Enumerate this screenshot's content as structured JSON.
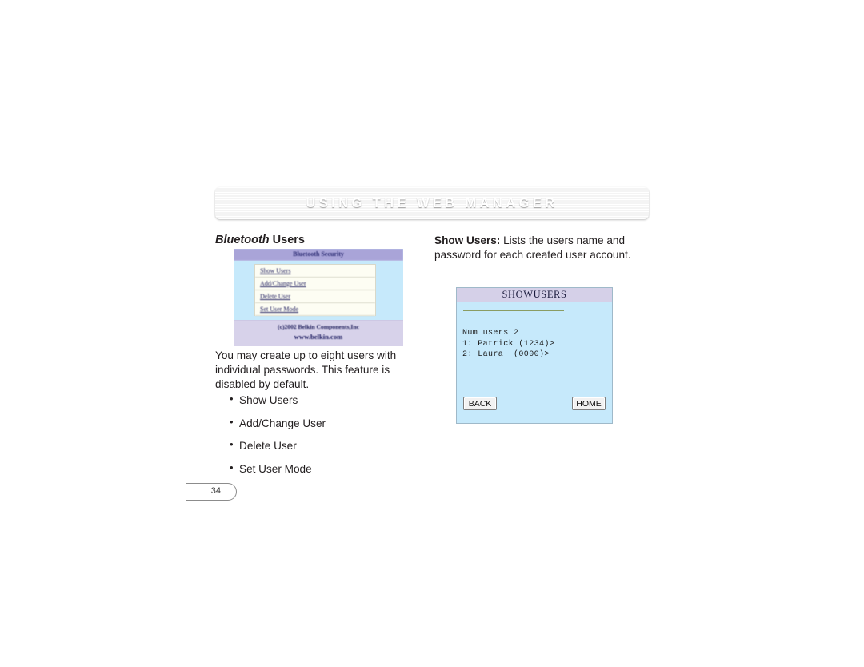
{
  "document": {
    "banner_title": "USING THE WEB MANAGER",
    "page_number": "34"
  },
  "left_column": {
    "heading_emphasis": "Bluetooth",
    "heading_rest": " Users",
    "paragraph": "You may create up to eight users with individual passwords. This feature is disabled by default.",
    "bullets": [
      "Show Users",
      "Add/Change User",
      "Delete User",
      "Set User Mode"
    ]
  },
  "right_column": {
    "lead": "Show Users:",
    "description": " Lists the users name and password for each created user account."
  },
  "web_manager_figure": {
    "title": "Bluetooth Security",
    "menu_items": [
      "Show Users",
      "Add/Change User",
      "Delete User",
      "Set User Mode"
    ],
    "copyright": "(c)2002 Belkin Components,Inc",
    "url": "www.belkin.com"
  },
  "lcd_figure": {
    "title": "SHOWUSERS",
    "lines": [
      "Num users 2",
      "1: Patrick (1234)>",
      "2: Laura  (0000)>"
    ],
    "back_button": "BACK",
    "home_button": "HOME"
  },
  "colors": {
    "banner_blue": "#5463ad",
    "lcd_background": "#c6e9fb",
    "lcd_titlebar": "#d5d0e8",
    "web_titlebar": "#a9a4d8",
    "web_footer": "#d7d2ea",
    "text": "#231f20"
  }
}
